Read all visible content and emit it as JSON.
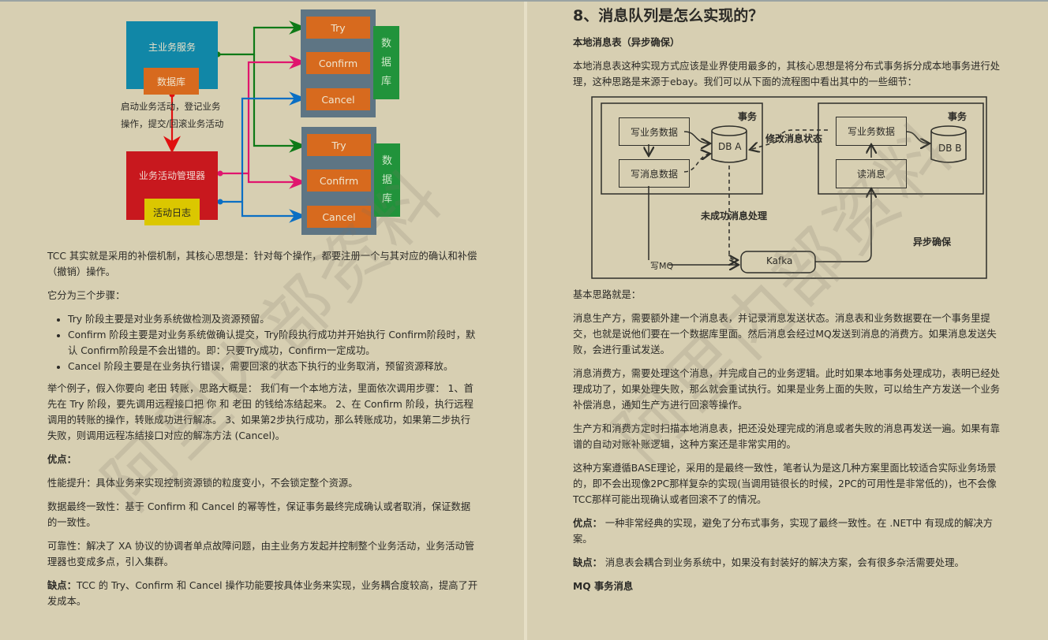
{
  "left_page": {
    "diagram": {
      "main_service": "主业务服务",
      "main_db": "数据库",
      "caption_line1": "启动业务活动，登记业务",
      "caption_line2": "操作，提交/回滚业务活动",
      "manager": "业务活动管理器",
      "activity_log": "活动日志",
      "service_groups": [
        {
          "try": "Try",
          "confirm": "Confirm",
          "cancel": "Cancel",
          "db": [
            "数",
            "据",
            "库"
          ]
        },
        {
          "try": "Try",
          "confirm": "Confirm",
          "cancel": "Cancel",
          "db": [
            "数",
            "据",
            "库"
          ]
        }
      ],
      "colors": {
        "main_service": "#1187a7",
        "db_orange": "#d76a1e",
        "service_bg": "#5e7584",
        "db_green": "#21933b",
        "manager_red": "#c8181e",
        "log_yellow": "#dbc700",
        "try_arrow": "#0e7a17",
        "confirm_arrow": "#e0156e",
        "cancel_arrow": "#0a6fc4",
        "red_arrow": "#e01010"
      }
    },
    "paragraphs": {
      "p1": "TCC 其实就是采用的补偿机制，其核心思想是：针对每个操作，都要注册一个与其对应的确认和补偿（撤销）操作。",
      "p2": "它分为三个步骤：",
      "steps": [
        "Try 阶段主要是对业务系统做检测及资源预留。",
        "Confirm 阶段主要是对业务系统做确认提交，Try阶段执行成功并开始执行 Confirm阶段时，默认 Confirm阶段是不会出错的。即：只要Try成功，Confirm一定成功。",
        "Cancel 阶段主要是在业务执行错误，需要回滚的状态下执行的业务取消，预留资源释放。"
      ],
      "p3": "举个例子，假入你要向 老田 转账，思路大概是： 我们有一个本地方法，里面依次调用步骤： 1、首先在 Try 阶段，要先调用远程接口把 你 和 老田 的钱给冻结起来。 2、在 Confirm 阶段，执行远程调用的转账的操作，转账成功进行解冻。 3、如果第2步执行成功，那么转账成功，如果第二步执行失败，则调用远程冻结接口对应的解冻方法 (Cancel)。",
      "pros_heading": "优点：",
      "pro1": "性能提升：具体业务来实现控制资源锁的粒度变小，不会锁定整个资源。",
      "pro2": "数据最终一致性：基于 Confirm 和 Cancel 的幂等性，保证事务最终完成确认或者取消，保证数据的一致性。",
      "pro3": "可靠性：解决了 XA 协议的协调者单点故障问题，由主业务方发起并控制整个业务活动，业务活动管理器也变成多点，引入集群。",
      "cons_label": "缺点：",
      "cons_text": "TCC 的 Try、Confirm 和 Cancel 操作功能要按具体业务来实现，业务耦合度较高，提高了开发成本。"
    }
  },
  "right_page": {
    "title": "8、消息队列是怎么实现的？",
    "subtitle": "本地消息表（异步确保）",
    "intro": "本地消息表这种实现方式应该是业界使用最多的，其核心思想是将分布式事务拆分成本地事务进行处理，这种思路是来源于ebay。我们可以从下面的流程图中看出其中的一些细节：",
    "diagram": {
      "left_tx_label": "事务",
      "right_tx_label": "事务",
      "write_business_left": "写业务数据",
      "write_message": "写消息数据",
      "db_a": "DB A",
      "modify_status": "修改消息状态",
      "write_business_right": "写业务数据",
      "read_message": "读消息",
      "db_b": "DB B",
      "failed_handling": "未成功消息处理",
      "write_mq": "写MQ",
      "kafka": "Kafka",
      "async_ensure": "异步确保"
    },
    "basic_idea": "基本思路就是：",
    "producer": "消息生产方，需要额外建一个消息表，并记录消息发送状态。消息表和业务数据要在一个事务里提交，也就是说他们要在一个数据库里面。然后消息会经过MQ发送到消息的消费方。如果消息发送失败，会进行重试发送。",
    "consumer": "消息消费方，需要处理这个消息，并完成自己的业务逻辑。此时如果本地事务处理成功，表明已经处理成功了，如果处理失败，那么就会重试执行。如果是业务上面的失败，可以给生产方发送一个业务补偿消息，通知生产方进行回滚等操作。",
    "scan": "生产方和消费方定时扫描本地消息表，把还没处理完成的消息或者失败的消息再发送一遍。如果有靠谱的自动对账补账逻辑，这种方案还是非常实用的。",
    "base": "这种方案遵循BASE理论，采用的是最终一致性，笔者认为是这几种方案里面比较适合实际业务场景的，即不会出现像2PC那样复杂的实现(当调用链很长的时候，2PC的可用性是非常低的)，也不会像TCC那样可能出现确认或者回滚不了的情况。",
    "pros_label": "优点：",
    "pros_text": " 一种非常经典的实现，避免了分布式事务，实现了最终一致性。在 .NET中 有现成的解决方案。",
    "cons_label": "缺点：",
    "cons_text": " 消息表会耦合到业务系统中，如果没有封装好的解决方案，会有很多杂活需要处理。",
    "mq_heading": "MQ 事务消息"
  },
  "watermark": "阿里内部资料"
}
